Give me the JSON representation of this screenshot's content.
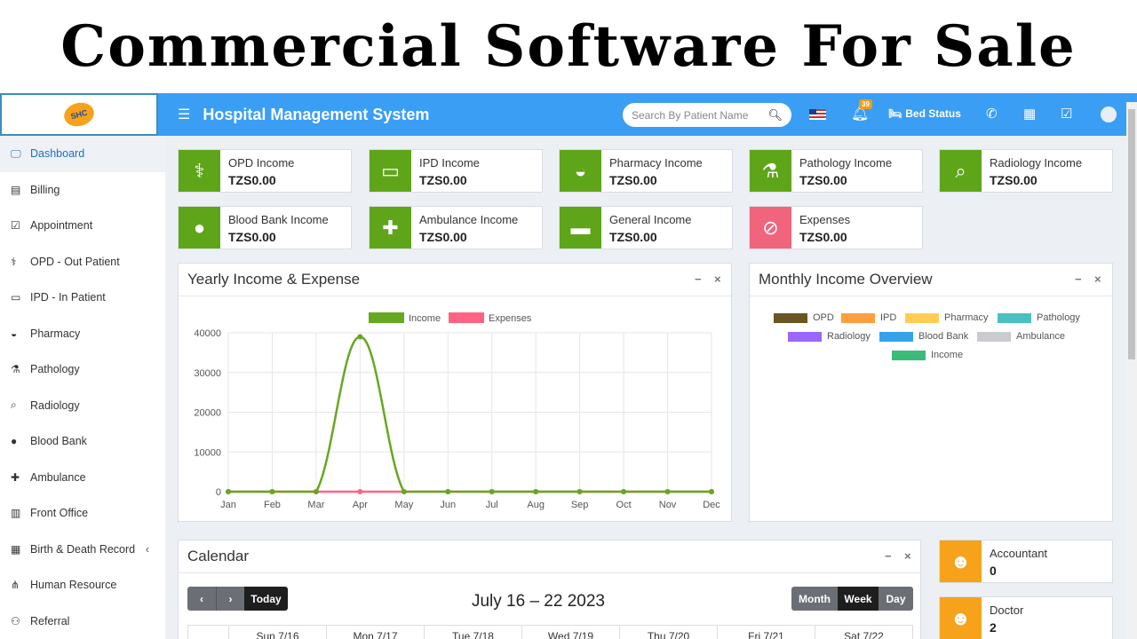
{
  "banner": {
    "title": "Commercial Software For Sale"
  },
  "header": {
    "app_title": "Hospital Management System",
    "search_placeholder": "Search By Patient Name",
    "notif_count": "39",
    "bed_status": "Bed Status"
  },
  "sidebar": {
    "items": [
      {
        "label": "Dashboard",
        "icon": "monitor-icon",
        "active": true
      },
      {
        "label": "Billing",
        "icon": "file-icon"
      },
      {
        "label": "Appointment",
        "icon": "calendar-check-icon"
      },
      {
        "label": "OPD - Out Patient",
        "icon": "stethoscope-icon"
      },
      {
        "label": "IPD - In Patient",
        "icon": "bed-icon"
      },
      {
        "label": "Pharmacy",
        "icon": "mortar-pestle-icon"
      },
      {
        "label": "Pathology",
        "icon": "flask-icon"
      },
      {
        "label": "Radiology",
        "icon": "microscope-icon"
      },
      {
        "label": "Blood Bank",
        "icon": "drop-icon"
      },
      {
        "label": "Ambulance",
        "icon": "ambulance-icon"
      },
      {
        "label": "Front Office",
        "icon": "building-icon"
      },
      {
        "label": "Birth & Death Record",
        "icon": "record-icon",
        "caret": "‹"
      },
      {
        "label": "Human Resource",
        "icon": "sitemap-icon"
      },
      {
        "label": "Referral",
        "icon": "users-icon"
      }
    ]
  },
  "income_cards": [
    {
      "label": "OPD Income",
      "value": "TZS0.00",
      "color": "#5ea51a",
      "icon": "stethoscope-icon"
    },
    {
      "label": "IPD Income",
      "value": "TZS0.00",
      "color": "#5ea51a",
      "icon": "bed-icon"
    },
    {
      "label": "Pharmacy Income",
      "value": "TZS0.00",
      "color": "#5ea51a",
      "icon": "mortar-pestle-icon"
    },
    {
      "label": "Pathology Income",
      "value": "TZS0.00",
      "color": "#5ea51a",
      "icon": "flask-icon"
    },
    {
      "label": "Radiology Income",
      "value": "TZS0.00",
      "color": "#5ea51a",
      "icon": "microscope-icon"
    },
    {
      "label": "Blood Bank Income",
      "value": "TZS0.00",
      "color": "#5ea51a",
      "icon": "drop-icon"
    },
    {
      "label": "Ambulance Income",
      "value": "TZS0.00",
      "color": "#5ea51a",
      "icon": "ambulance-icon"
    },
    {
      "label": "General Income",
      "value": "TZS0.00",
      "color": "#5ea51a",
      "icon": "money-icon"
    },
    {
      "label": "Expenses",
      "value": "TZS0.00",
      "color": "#f0647c",
      "icon": "no-money-icon"
    }
  ],
  "yearly_panel": {
    "title": "Yearly Income & Expense"
  },
  "monthly_panel": {
    "title": "Monthly Income Overview",
    "legend": [
      {
        "name": "OPD",
        "color": "#6b5520"
      },
      {
        "name": "IPD",
        "color": "#ff9f40"
      },
      {
        "name": "Pharmacy",
        "color": "#ffcd56"
      },
      {
        "name": "Pathology",
        "color": "#4bc0c0"
      },
      {
        "name": "Radiology",
        "color": "#9966ff"
      },
      {
        "name": "Blood Bank",
        "color": "#36a2eb"
      },
      {
        "name": "Ambulance",
        "color": "#c9cbcf"
      },
      {
        "name": "Income",
        "color": "#3cba7a"
      }
    ]
  },
  "chart_data": {
    "type": "line",
    "categories": [
      "Jan",
      "Feb",
      "Mar",
      "Apr",
      "May",
      "Jun",
      "Jul",
      "Aug",
      "Sep",
      "Oct",
      "Nov",
      "Dec"
    ],
    "series": [
      {
        "name": "Income",
        "color": "#66a81f",
        "values": [
          0,
          0,
          0,
          39000,
          0,
          0,
          0,
          0,
          0,
          0,
          0,
          0
        ]
      },
      {
        "name": "Expenses",
        "color": "#ff6384",
        "values": [
          0,
          0,
          0,
          0,
          0,
          0,
          0,
          0,
          0,
          0,
          0,
          0
        ]
      }
    ],
    "yticks": [
      0,
      10000,
      20000,
      30000,
      40000
    ],
    "ylim": [
      0,
      40000
    ],
    "legend_position": "top",
    "grid": true
  },
  "calendar": {
    "title": "Calendar",
    "prev": "‹",
    "next": "›",
    "today": "Today",
    "range": "July 16 – 22 2023",
    "views": [
      "Month",
      "Week",
      "Day"
    ],
    "days": [
      "Sun 7/16",
      "Mon 7/17",
      "Tue 7/18",
      "Wed 7/19",
      "Thu 7/20",
      "Fri 7/21",
      "Sat 7/22"
    ]
  },
  "staff_cards": [
    {
      "label": "Accountant",
      "value": "0",
      "color": "#f7a21b"
    },
    {
      "label": "Doctor",
      "value": "2",
      "color": "#f7a21b"
    }
  ]
}
